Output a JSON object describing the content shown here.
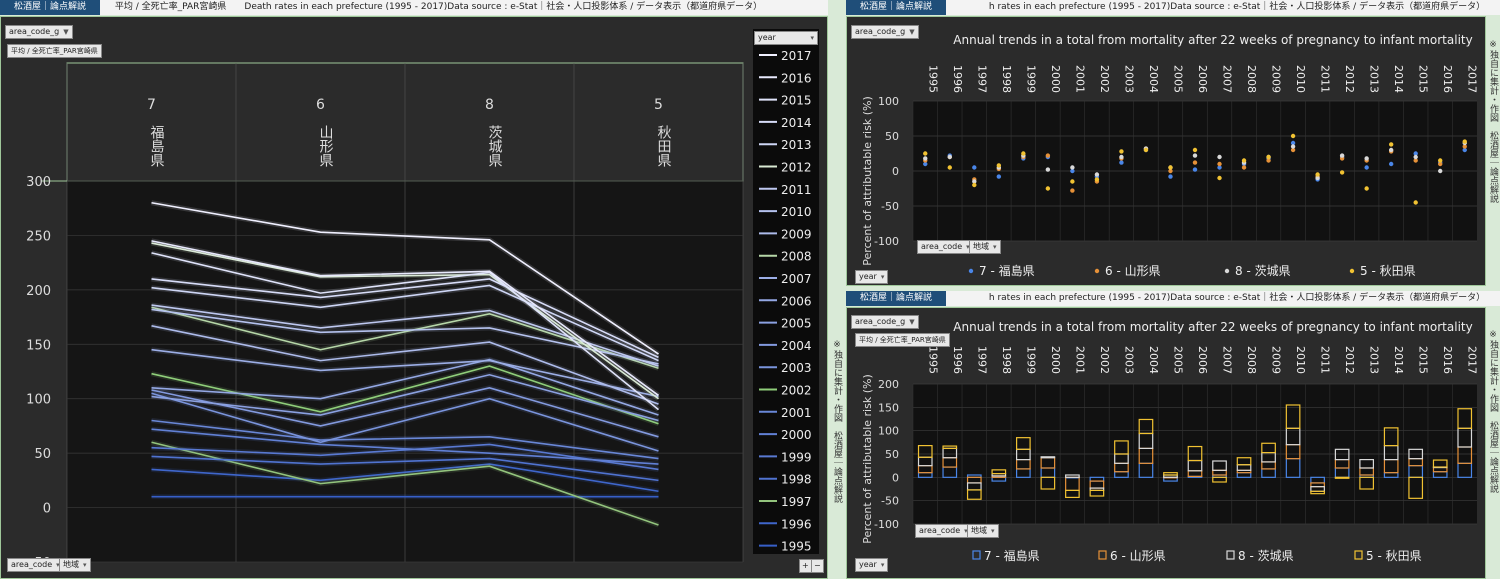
{
  "left": {
    "brand": "松酒屋｜論点解説",
    "bar_text": "平均 / 全死亡率_PAR宮崎県　　Death rates in each prefecture (1995 - 2017)Data source : e-Stat｜社会・人口投影体系 / データ表示（都道府県データ）",
    "filter_area_code": "area_code_g",
    "measure_label": "平均 / 全死亡率_PAR宮崎県",
    "legend_header": "year",
    "bottom_area_code": "area_code",
    "bottom_region": "地域",
    "side_note": "※独自に集計・作図　松酒屋｜論点解説",
    "zoom_plus": "+",
    "zoom_minus": "−"
  },
  "right_top": {
    "brand": "松酒屋｜論点解説",
    "bar_text": "h rates in each prefecture (1995 - 2017)Data source : e-Stat｜社会・人口投影体系 / データ表示（都道府県データ）",
    "filter_area_code": "area_code_g",
    "year_button": "year",
    "area_code_button": "area_code",
    "region_button": "地域",
    "side_note": "※独自に集計・作図　松酒屋｜論点解説"
  },
  "right_bottom": {
    "brand": "松酒屋｜論点解説",
    "bar_text": "h rates in each prefecture (1995 - 2017)Data source : e-Stat｜社会・人口投影体系 / データ表示（都道府県データ）",
    "filter_area_code": "area_code_g",
    "measure_label": "平均 / 全死亡率_PAR宮崎県",
    "year_button": "year",
    "area_code_button": "area_code",
    "region_button": "地域",
    "side_note": "※独自に集計・作図　松酒屋｜論点解説"
  },
  "colors": {
    "fukushima": "#4a86e8",
    "yamagata": "#e69138",
    "ibaraki": "#d9d9d9",
    "akita": "#f1c232"
  },
  "chart_data": [
    {
      "type": "line",
      "categories": [
        "7",
        "6",
        "8",
        "5"
      ],
      "category_names": [
        "福島県",
        "山形県",
        "茨城県",
        "秋田県"
      ],
      "ylim": [
        -50,
        300
      ],
      "yticks": [
        -50,
        0,
        50,
        100,
        150,
        200,
        250,
        300
      ],
      "series": [
        {
          "name": "2017",
          "values": [
            280,
            253,
            246,
            141
          ]
        },
        {
          "name": "2016",
          "values": [
            245,
            213,
            217,
            103
          ]
        },
        {
          "name": "2015",
          "values": [
            234,
            197,
            216,
            90
          ]
        },
        {
          "name": "2014",
          "values": [
            210,
            193,
            210,
            138
          ]
        },
        {
          "name": "2013",
          "values": [
            202,
            184,
            204,
            135
          ]
        },
        {
          "name": "2012",
          "values": [
            243,
            212,
            214,
            100
          ]
        },
        {
          "name": "2011",
          "values": [
            186,
            165,
            181,
            130
          ]
        },
        {
          "name": "2010",
          "values": [
            182,
            161,
            165,
            132
          ]
        },
        {
          "name": "2009",
          "values": [
            167,
            135,
            152,
            95
          ]
        },
        {
          "name": "2008",
          "values": [
            184,
            145,
            178,
            128
          ]
        },
        {
          "name": "2007",
          "values": [
            145,
            126,
            135,
            102
          ]
        },
        {
          "name": "2006",
          "values": [
            110,
            100,
            136,
            85
          ]
        },
        {
          "name": "2005",
          "values": [
            102,
            85,
            122,
            80
          ]
        },
        {
          "name": "2004",
          "values": [
            108,
            75,
            110,
            65
          ]
        },
        {
          "name": "2003",
          "values": [
            105,
            60,
            100,
            52
          ]
        },
        {
          "name": "2002",
          "values": [
            123,
            88,
            130,
            77
          ]
        },
        {
          "name": "2001",
          "values": [
            80,
            62,
            65,
            45
          ]
        },
        {
          "name": "2000",
          "values": [
            72,
            58,
            50,
            40
          ]
        },
        {
          "name": "1999",
          "values": [
            55,
            48,
            58,
            35
          ]
        },
        {
          "name": "1998",
          "values": [
            47,
            40,
            45,
            25
          ]
        },
        {
          "name": "1997",
          "values": [
            60,
            22,
            38,
            -16
          ]
        },
        {
          "name": "1996",
          "values": [
            35,
            25,
            40,
            15
          ]
        },
        {
          "name": "1995",
          "values": [
            10,
            10,
            10,
            10
          ]
        }
      ]
    },
    {
      "type": "scatter",
      "title": "Annual trends in a total from mortality after 22 weeks of pregnancy to infant mortality",
      "ylabel": "Percent of attributable risk (%)",
      "ylim": [
        -100,
        100
      ],
      "yticks": [
        -100,
        -50,
        0,
        50,
        100
      ],
      "categories": [
        "1995",
        "1996",
        "1997",
        "1998",
        "1999",
        "2000",
        "2001",
        "2002",
        "2003",
        "2004",
        "2005",
        "2006",
        "2007",
        "2008",
        "2009",
        "2010",
        "2011",
        "2012",
        "2013",
        "2014",
        "2015",
        "2016",
        "2017"
      ],
      "series": [
        {
          "name": "7 - 福島県",
          "values": [
            10,
            22,
            5,
            -8,
            18,
            20,
            0,
            -8,
            12,
            30,
            -8,
            2,
            5,
            10,
            18,
            40,
            -12,
            20,
            5,
            10,
            25,
            12,
            30
          ]
        },
        {
          "name": "6 - 山形県",
          "values": [
            15,
            20,
            -12,
            3,
            20,
            22,
            -28,
            -15,
            18,
            32,
            0,
            12,
            10,
            5,
            15,
            30,
            -8,
            18,
            15,
            28,
            15,
            10,
            35
          ]
        },
        {
          "name": "8 - 茨城県",
          "values": [
            18,
            20,
            -15,
            5,
            22,
            2,
            5,
            -5,
            20,
            32,
            5,
            22,
            20,
            12,
            20,
            35,
            -10,
            22,
            18,
            30,
            20,
            0,
            40
          ]
        },
        {
          "name": "5 - 秋田県",
          "values": [
            25,
            5,
            -20,
            8,
            25,
            -25,
            -15,
            -12,
            28,
            30,
            5,
            30,
            -10,
            15,
            20,
            50,
            -5,
            -2,
            -25,
            38,
            -45,
            15,
            42
          ]
        }
      ]
    },
    {
      "type": "bar",
      "title": "Annual trends in a total from mortality after 22 weeks of pregnancy to infant mortality",
      "ylabel": "Percent of attributable risk (%)",
      "ylim": [
        -100,
        200
      ],
      "yticks": [
        -100,
        -50,
        0,
        50,
        100,
        150,
        200
      ],
      "categories": [
        "1995",
        "1996",
        "1997",
        "1998",
        "1999",
        "2000",
        "2001",
        "2002",
        "2003",
        "2004",
        "2005",
        "2006",
        "2007",
        "2008",
        "2009",
        "2010",
        "2011",
        "2012",
        "2013",
        "2014",
        "2015",
        "2016",
        "2017"
      ],
      "stacked": true,
      "series": [
        {
          "name": "7 - 福島県",
          "values": [
            10,
            22,
            5,
            -8,
            18,
            20,
            0,
            -8,
            12,
            30,
            -8,
            2,
            5,
            10,
            18,
            40,
            -12,
            20,
            5,
            10,
            25,
            12,
            30
          ]
        },
        {
          "name": "6 - 山形県",
          "values": [
            15,
            20,
            -12,
            3,
            20,
            22,
            -28,
            -15,
            18,
            32,
            0,
            12,
            10,
            5,
            15,
            30,
            -8,
            18,
            15,
            28,
            15,
            10,
            35
          ]
        },
        {
          "name": "8 - 茨城県",
          "values": [
            18,
            20,
            -15,
            5,
            22,
            2,
            5,
            -5,
            20,
            32,
            5,
            22,
            20,
            12,
            20,
            35,
            -10,
            22,
            18,
            30,
            20,
            0,
            40
          ]
        },
        {
          "name": "5 - 秋田県",
          "values": [
            25,
            5,
            -20,
            8,
            25,
            -25,
            -15,
            -12,
            28,
            30,
            5,
            30,
            -10,
            15,
            20,
            50,
            -5,
            -2,
            -25,
            38,
            -45,
            15,
            42
          ]
        }
      ]
    }
  ]
}
